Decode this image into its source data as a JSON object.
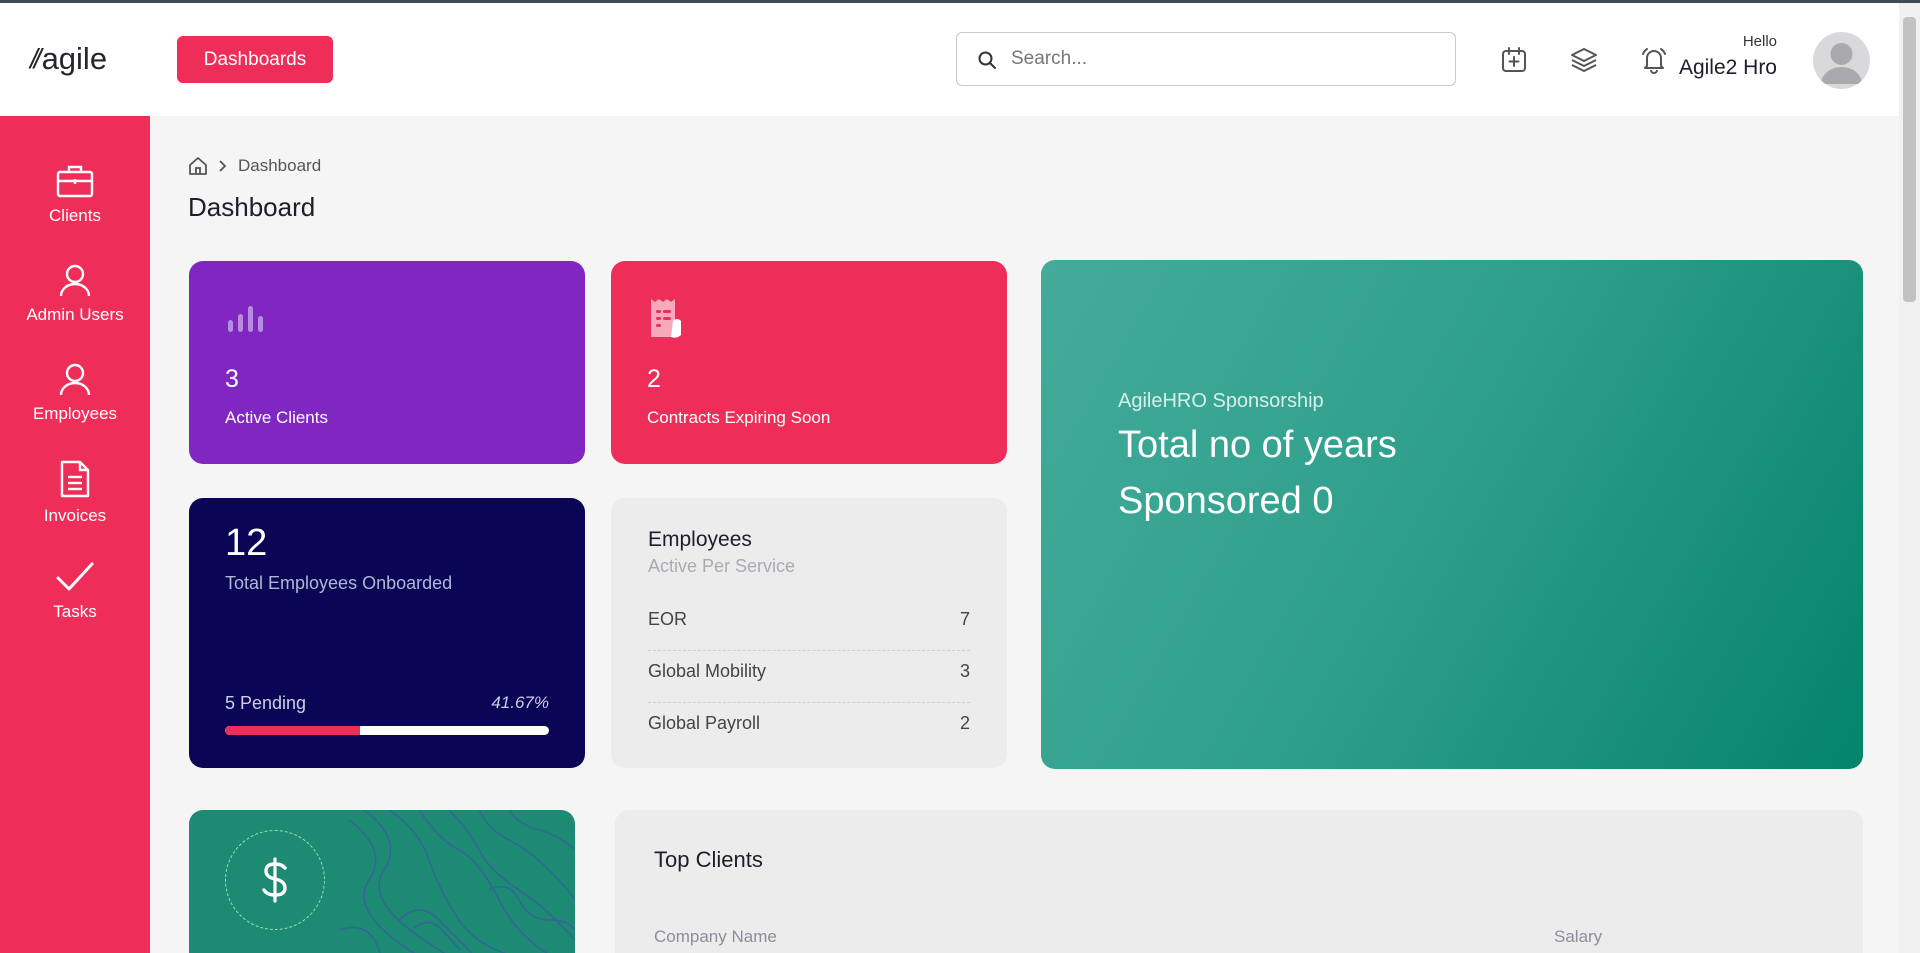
{
  "header": {
    "logo_text": "agile",
    "logo_slashes": "//",
    "dashboards_button": "Dashboards",
    "search": {
      "placeholder": "Search..."
    },
    "icons": [
      "calendar-add-icon",
      "layers-icon",
      "bell-icon"
    ],
    "greeting": "Hello",
    "user_name": "Agile2 Hro"
  },
  "sidebar": {
    "items": [
      {
        "label": "Clients",
        "icon": "briefcase-icon"
      },
      {
        "label": "Admin Users",
        "icon": "user-icon"
      },
      {
        "label": "Employees",
        "icon": "user-icon"
      },
      {
        "label": "Invoices",
        "icon": "document-icon"
      },
      {
        "label": "Tasks",
        "icon": "check-icon"
      }
    ]
  },
  "breadcrumb": {
    "current": "Dashboard"
  },
  "page_title": "Dashboard",
  "cards": {
    "active_clients": {
      "value": "3",
      "label": "Active Clients"
    },
    "contracts_expiring": {
      "value": "2",
      "label": "Contracts Expiring Soon"
    },
    "onboarded": {
      "value": "12",
      "label": "Total Employees Onboarded",
      "pending_label": "5 Pending",
      "percent_label": "41.67%",
      "progress_fraction": 0.4167
    },
    "employees": {
      "title": "Employees",
      "subtitle": "Active Per Service",
      "rows": [
        {
          "name": "EOR",
          "count": "7"
        },
        {
          "name": "Global Mobility",
          "count": "3"
        },
        {
          "name": "Global Payroll",
          "count": "2"
        }
      ]
    },
    "sponsorship": {
      "subtitle": "AgileHRO Sponsorship",
      "line1": "Total no of years",
      "line2": "Sponsored 0"
    },
    "money": {
      "symbol": "$"
    },
    "top_clients": {
      "title": "Top Clients",
      "columns": [
        "Company Name",
        "Salary"
      ]
    }
  },
  "colors": {
    "brand_red": "#ee2e59",
    "purple": "#7f27c0",
    "navy": "#0a0555",
    "teal": "#05836b"
  }
}
